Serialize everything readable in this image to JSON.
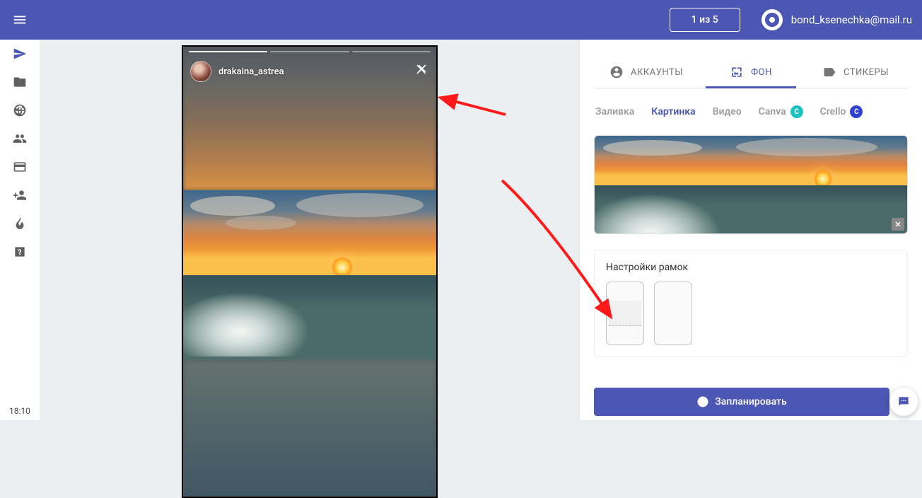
{
  "header": {
    "counter_label": "1 из 5",
    "user_email": "bond_ksenechka@mail.ru"
  },
  "sidebar": {
    "clock": "18:10"
  },
  "story": {
    "username": "drakaina_astrea",
    "progress_segments": 3,
    "progress_filled": 1
  },
  "panel": {
    "main_tabs": {
      "accounts": "АККАУНТЫ",
      "background": "ФОН",
      "stickers": "СТИКЕРЫ"
    },
    "sub_tabs": {
      "fill": "Заливка",
      "image": "Картинка",
      "video": "Видео",
      "canva": "Canva",
      "crello": "Crello"
    },
    "frame_settings_title": "Настройки рамок",
    "submit_label": "Запланировать"
  }
}
